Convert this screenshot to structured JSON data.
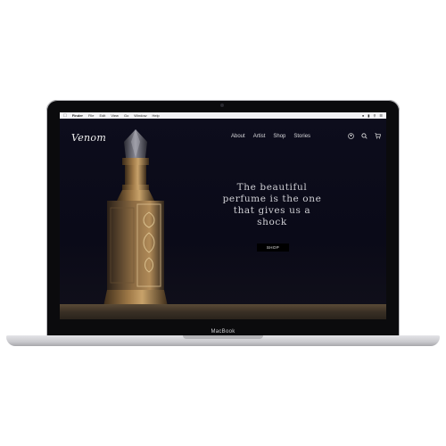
{
  "menubar": {
    "app": "Finder",
    "items": [
      "File",
      "Edit",
      "View",
      "Go",
      "Window",
      "Help"
    ]
  },
  "site": {
    "logo": "Venom",
    "nav": [
      "About",
      "Artist",
      "Shop",
      "Stories"
    ],
    "icons": [
      "account-icon",
      "search-icon",
      "cart-icon"
    ],
    "hero_text": "The beautiful perfume is the one that gives us a shock",
    "cta_label": "SHOP"
  },
  "device": {
    "brand": "MacBook"
  },
  "colors": {
    "site_bg": "#0c0c1a",
    "button_bg": "#000000",
    "text": "#cfcfd4"
  }
}
